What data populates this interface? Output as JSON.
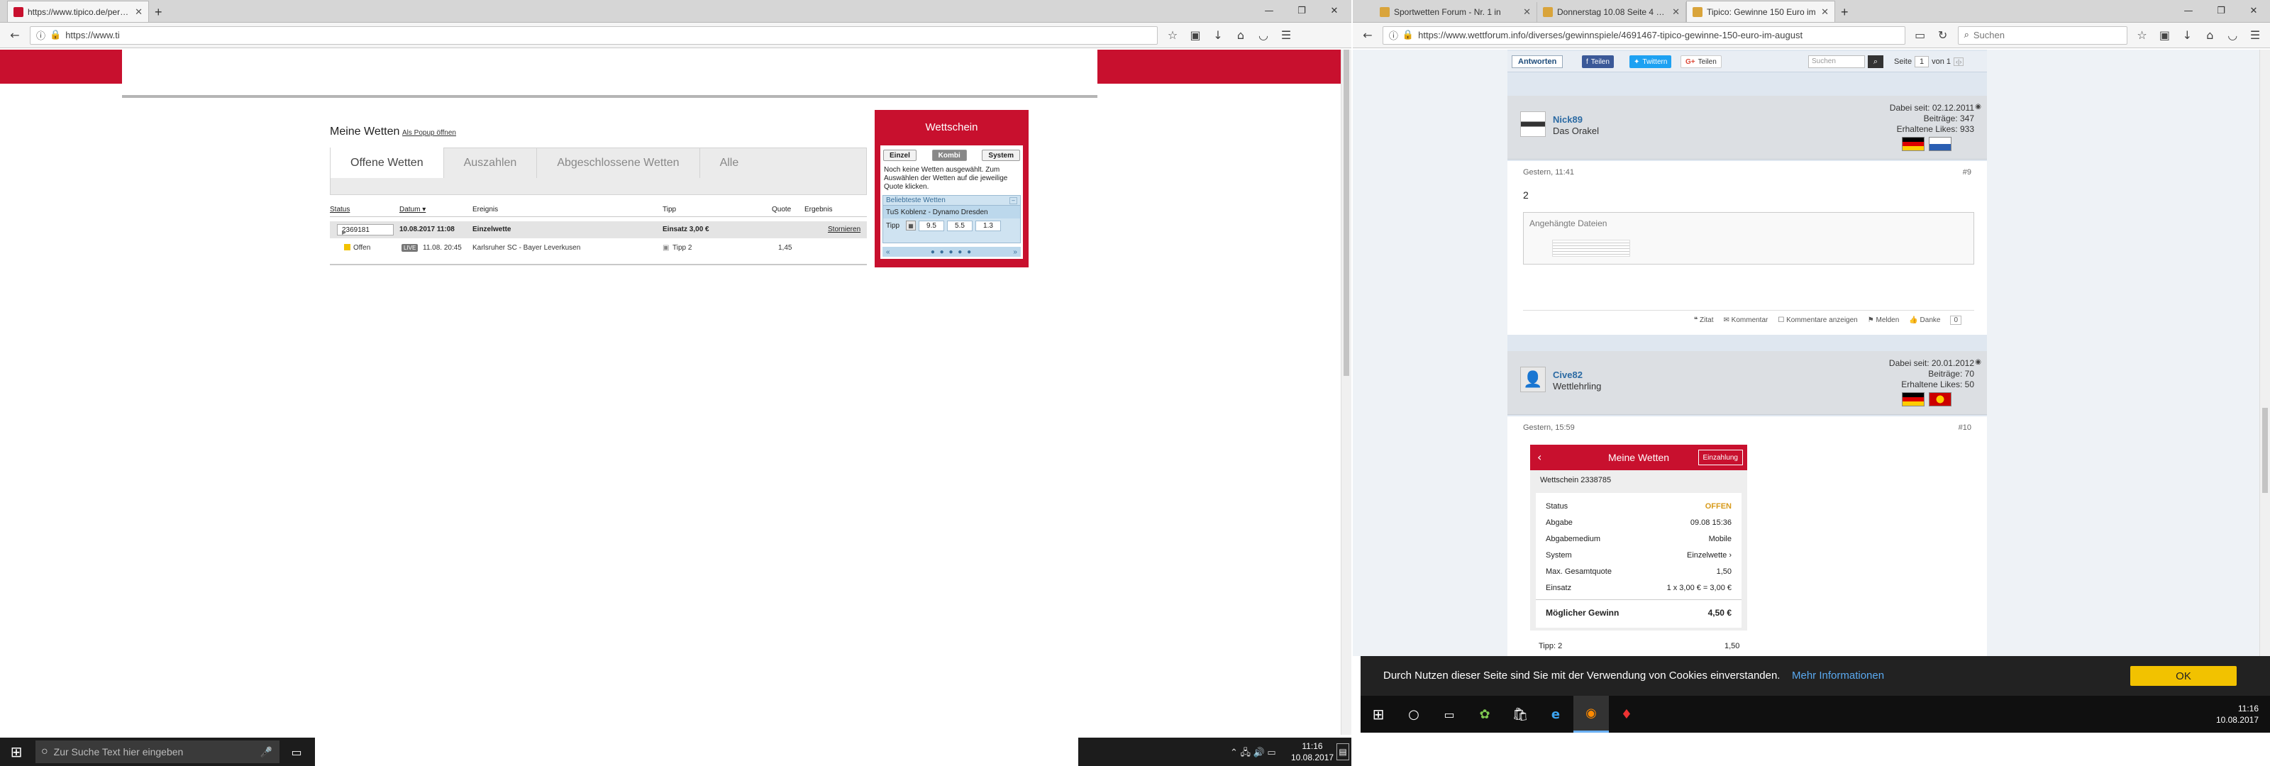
{
  "left_browser": {
    "tab": {
      "title": "https://www.tipico.de/pers…",
      "close": "✕",
      "new_tab": "+"
    },
    "url": "https://www.ti",
    "window_buttons": [
      "—",
      "❐",
      "✕"
    ],
    "menu_icon": "☰"
  },
  "tipico": {
    "heading": "Meine Wetten",
    "popup_link": "Als Popup öffnen",
    "tabs": [
      "Offene Wetten",
      "Auszahlen",
      "Abgeschlossene Wetten",
      "Alle"
    ],
    "columns": {
      "status": "Status",
      "datum": "Datum ▾",
      "ereignis": "Ereignis",
      "tipp": "Tipp",
      "quote": "Quote",
      "ergebnis": "Ergebnis"
    },
    "bet": {
      "id": "2369181",
      "date": "10.08.2017 11:08",
      "type": "Einzelwette",
      "stake": "Einsatz 3,00 €",
      "cancel": "Stornieren"
    },
    "event": {
      "status": "Offen",
      "live": "LIVE",
      "time": "11.08. 20:45",
      "match": "Karlsruher SC - Bayer Leverkusen",
      "tipp": "Tipp 2",
      "quote": "1,45"
    },
    "slip": {
      "title": "Wettschein",
      "tabs": [
        "Einzel",
        "Kombi",
        "System"
      ],
      "empty_text": "Noch keine Wetten ausgewählt. Zum Auswählen der Wetten auf die jeweilige Quote klicken.",
      "popular_label": "Beliebteste Wetten",
      "match": "TuS Koblenz - Dynamo Dresden",
      "tipp_label": "Tipp",
      "odds": [
        "9.5",
        "5.5",
        "1.3"
      ]
    }
  },
  "right_browser": {
    "tabs": [
      {
        "title": "Sportwetten Forum - Nr. 1 in"
      },
      {
        "title": "Donnerstag 10.08 Seite 4 von"
      },
      {
        "title": "Tipico: Gewinne 150 Euro im"
      }
    ],
    "new_tab": "+",
    "url": "https://www.wettforum.info/diverses/gewinnspiele/4691467-tipico-gewinne-150-euro-im-august",
    "search_placeholder": "Suchen",
    "window_buttons": [
      "—",
      "❐",
      "✕"
    ]
  },
  "forum": {
    "reply_button": "Antworten",
    "share": {
      "facebook": "Teilen",
      "twitter": "Twittern",
      "gplus": "Teilen"
    },
    "search_placeholder": "Suchen",
    "page_label": "Seite",
    "page_current": "1",
    "page_total": "von 1",
    "posts": [
      {
        "user": "Nick89",
        "title": "Das Orakel",
        "since": "Dabei seit: 02.12.2011",
        "posts": "Beiträge: 347",
        "likes": "Erhaltene Likes: 933",
        "date": "Gestern, 11:41",
        "num": "#9",
        "body": "2",
        "attachments_label": "Angehängte Dateien"
      },
      {
        "user": "Cive82",
        "title": "Wettlehrling",
        "since": "Dabei seit: 20.01.2012",
        "posts": "Beiträge: 70",
        "likes": "Erhaltene Likes: 50",
        "date": "Gestern, 15:59",
        "num": "#10"
      }
    ],
    "actions": [
      "Zitat",
      "Kommentar",
      "Kommentare anzeigen",
      "Melden",
      "Danke",
      "0"
    ],
    "phone": {
      "title": "Meine Wetten",
      "deposit": "Einzahlung",
      "slip": "Wettschein 2338785",
      "rows": [
        {
          "k": "Status",
          "v": "OFFEN"
        },
        {
          "k": "Abgabe",
          "v": "09.08 15:36"
        },
        {
          "k": "Abgabemedium",
          "v": "Mobile"
        },
        {
          "k": "System",
          "v": "Einzelwette"
        },
        {
          "k": "Max. Gesamtquote",
          "v": "1,50"
        },
        {
          "k": "Einsatz",
          "v": "1 x 3,00 € = 3,00 €"
        }
      ],
      "win_label": "Möglicher Gewinn",
      "win_value": "4,50 €"
    },
    "below_phone": {
      "tipp": "Tipp: 2",
      "quote": "1,50"
    }
  },
  "cookie": {
    "text": "Durch Nutzen dieser Seite sind Sie mit der Verwendung von Cookies einverstanden.",
    "link": "Mehr Informationen",
    "ok": "OK"
  },
  "taskbar_left": {
    "search_placeholder": "Zur Suche Text hier eingeben",
    "time": "11:16",
    "date": "10.08.2017"
  },
  "taskbar_right": {
    "time": "11:16",
    "date": "10.08.2017"
  }
}
